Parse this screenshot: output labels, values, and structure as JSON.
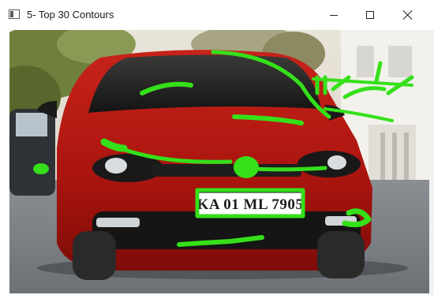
{
  "window": {
    "title": "5- Top 30 Contours",
    "icon": "opencv-window-icon"
  },
  "controls": {
    "minimize": "minimize-icon",
    "maximize": "maximize-icon",
    "close": "close-icon"
  },
  "image": {
    "plate_text": "KA 01 ML 7905",
    "contour_color": "#35e01a",
    "car_color": "#b5160f"
  }
}
